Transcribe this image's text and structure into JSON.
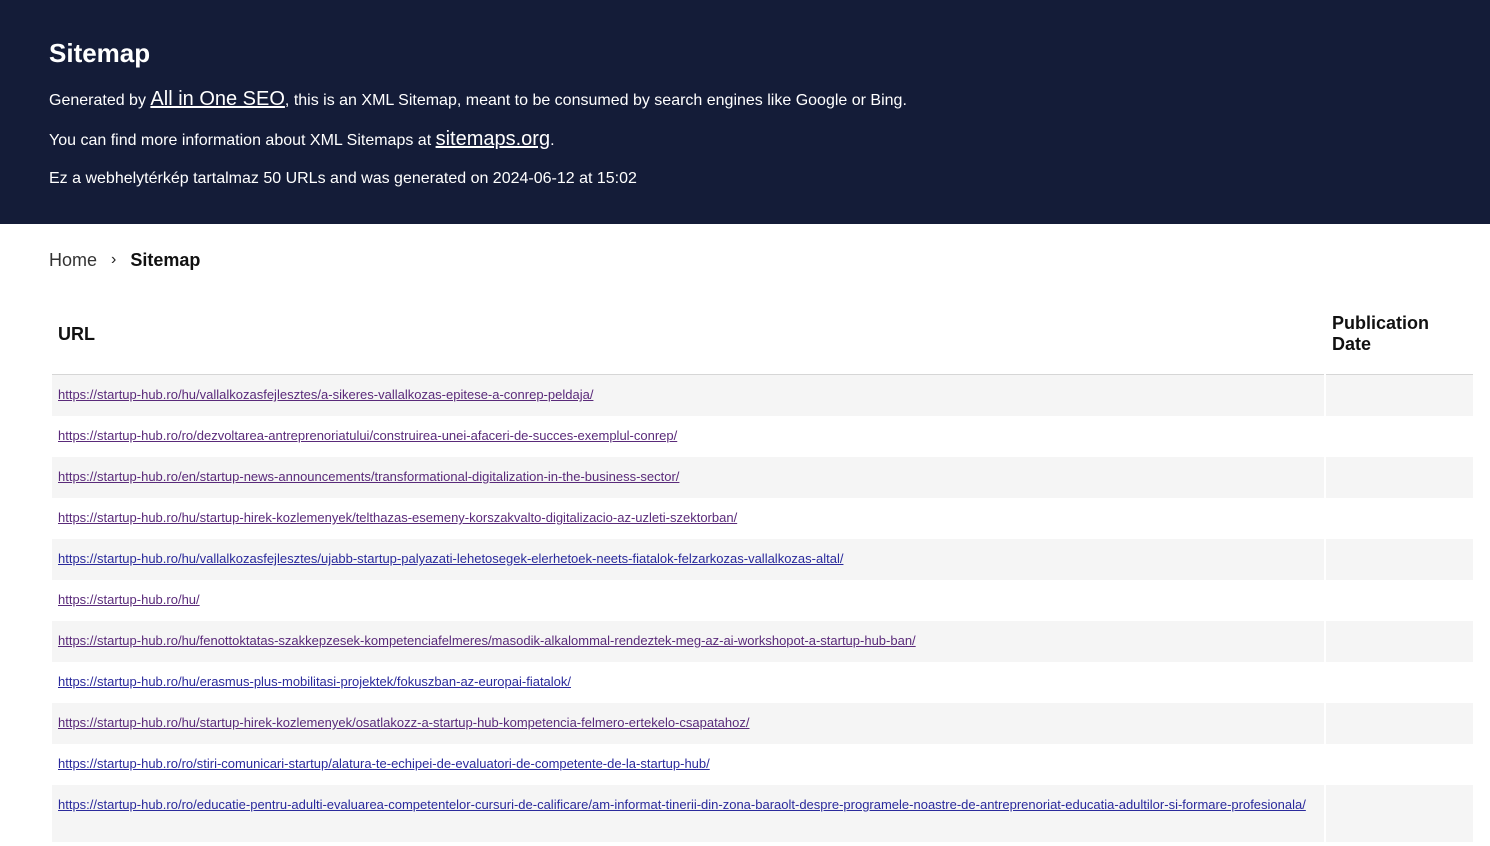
{
  "header": {
    "title": "Sitemap",
    "line1_prefix": "Generated by ",
    "line1_link": "All in One SEO",
    "line1_suffix": ", this is an XML Sitemap, meant to be consumed by search engines like Google or Bing.",
    "line2_prefix": "You can find more information about XML Sitemaps at ",
    "line2_link": "sitemaps.org",
    "line2_suffix": ".",
    "line3": "Ez a webhelytérkép tartalmaz 50 URLs and was generated on 2024-06-12 at 15:02"
  },
  "breadcrumb": {
    "home": "Home",
    "separator": "›",
    "current": "Sitemap"
  },
  "table": {
    "headers": {
      "url": "URL",
      "date": "Publication Date"
    },
    "rows": [
      {
        "url": "https://startup-hub.ro/hu/vallalkozasfejlesztes/a-sikeres-vallalkozas-epitese-a-conrep-peldaja/",
        "date": ""
      },
      {
        "url": "https://startup-hub.ro/ro/dezvoltarea-antreprenoriatului/construirea-unei-afaceri-de-succes-exemplul-conrep/",
        "date": ""
      },
      {
        "url": "https://startup-hub.ro/en/startup-news-announcements/transformational-digitalization-in-the-business-sector/",
        "date": ""
      },
      {
        "url": "https://startup-hub.ro/hu/startup-hirek-kozlemenyek/telthazas-esemeny-korszakvalto-digitalizacio-az-uzleti-szektorban/",
        "date": ""
      },
      {
        "url": "https://startup-hub.ro/hu/vallalkozasfejlesztes/ujabb-startup-palyazati-lehetosegek-elerhetoek-neets-fiatalok-felzarkozas-vallalkozas-altal/",
        "date": ""
      },
      {
        "url": "https://startup-hub.ro/hu/",
        "date": ""
      },
      {
        "url": "https://startup-hub.ro/hu/fenottoktatas-szakkepzesek-kompetenciafelmeres/masodik-alkalommal-rendeztek-meg-az-ai-workshopot-a-startup-hub-ban/",
        "date": ""
      },
      {
        "url": "https://startup-hub.ro/hu/erasmus-plus-mobilitasi-projektek/fokuszban-az-europai-fiatalok/",
        "date": ""
      },
      {
        "url": "https://startup-hub.ro/hu/startup-hirek-kozlemenyek/osatlakozz-a-startup-hub-kompetencia-felmero-ertekelo-csapatahoz/",
        "date": ""
      },
      {
        "url": "https://startup-hub.ro/ro/stiri-comunicari-startup/alatura-te-echipei-de-evaluatori-de-competente-de-la-startup-hub/",
        "date": ""
      },
      {
        "url": "https://startup-hub.ro/ro/educatie-pentru-adulti-evaluarea-competentelor-cursuri-de-calificare/am-informat-tinerii-din-zona-baraolt-despre-programele-noastre-de-antreprenoriat-educatia-adultilor-si-formare-profesionala/",
        "date": ""
      }
    ]
  },
  "colors": {
    "header_bg": "#141c38",
    "row_alt_bg": "#f5f5f5",
    "link": "#2a2a9c",
    "link_visited": "#5a2a7a"
  }
}
